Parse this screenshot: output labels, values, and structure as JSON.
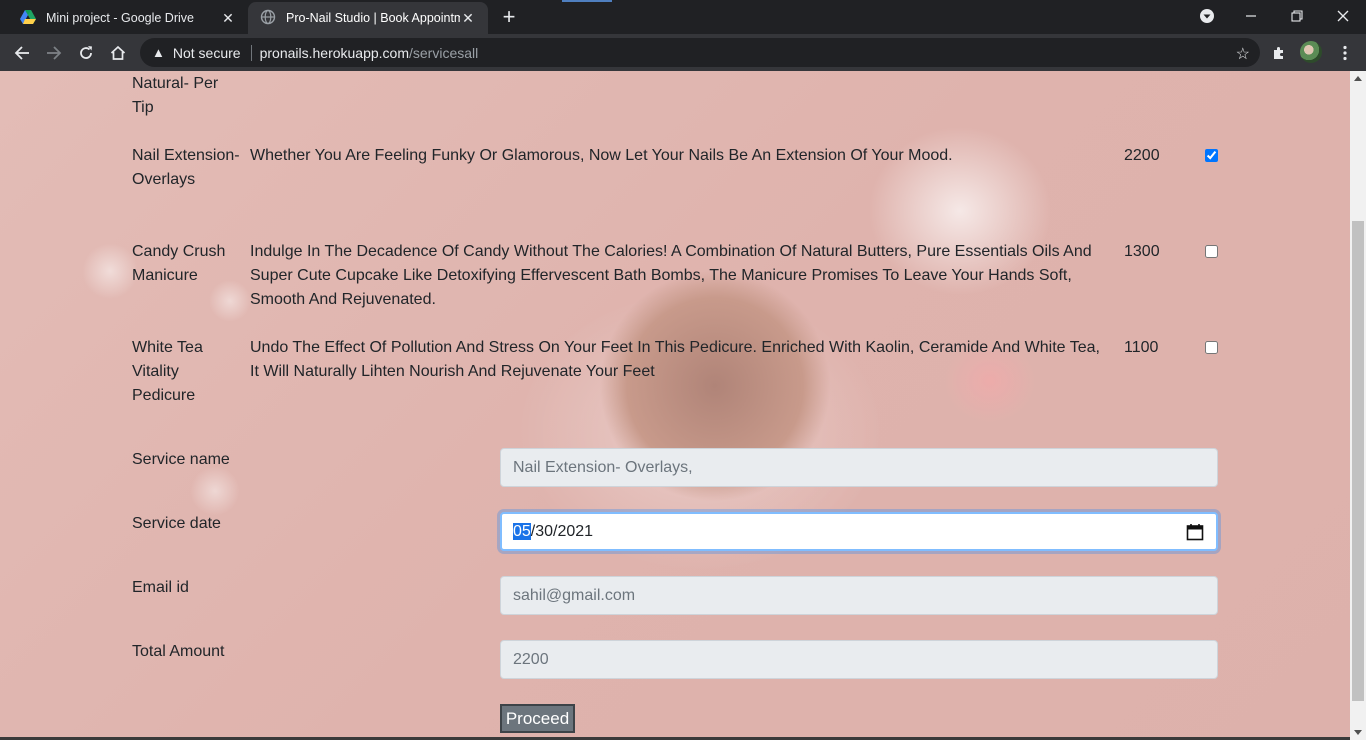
{
  "browser": {
    "tabs": [
      {
        "title": "Mini project - Google Drive",
        "icon": "google-drive-icon",
        "active": false
      },
      {
        "title": "Pro-Nail Studio | Book Appointment",
        "icon": "globe-icon",
        "active": true
      }
    ],
    "address": {
      "security_label": "Not secure",
      "host": "pronails.herokuapp.com",
      "path": "/servicesall"
    }
  },
  "services": [
    {
      "name": "Natural- Per Tip",
      "description": "",
      "price": "",
      "checked": false,
      "partial": true
    },
    {
      "name": "Nail Extension- Overlays",
      "description": "Whether You Are Feeling Funky Or Glamorous, Now Let Your Nails Be An Extension Of Your Mood.",
      "price": "2200",
      "checked": true
    },
    {
      "name": "Candy Crush Manicure",
      "description": "Indulge In The Decadence Of Candy Without The Calories! A Combination Of Natural Butters, Pure Essentials Oils And Super Cute Cupcake Like Detoxifying Effervescent Bath Bombs, The Manicure Promises To Leave Your Hands Soft, Smooth And Rejuvenated.",
      "price": "1300",
      "checked": false
    },
    {
      "name": "White Tea Vitality Pedicure",
      "description": "Undo The Effect Of Pollution And Stress On Your Feet In This Pedicure. Enriched With Kaolin, Ceramide And White Tea, It Will Naturally Lihten Nourish And Rejuvenate Your Feet",
      "price": "1100",
      "checked": false
    }
  ],
  "form": {
    "service_name": {
      "label": "Service name",
      "value": "Nail Extension- Overlays,"
    },
    "service_date": {
      "label": "Service date",
      "month": "05",
      "rest": "/30/2021"
    },
    "email": {
      "label": "Email id",
      "value": "sahil@gmail.com"
    },
    "total": {
      "label": "Total Amount",
      "value": "2200"
    },
    "proceed_label": "Proceed"
  }
}
